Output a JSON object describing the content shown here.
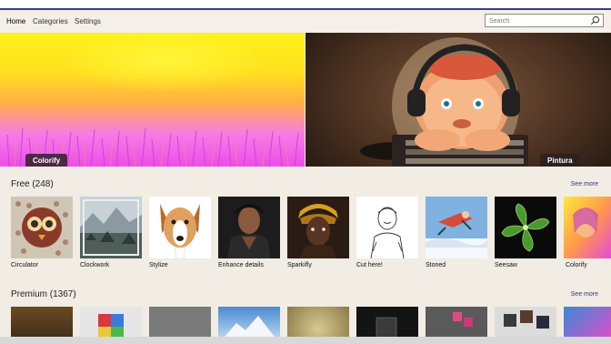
{
  "nav": {
    "items": [
      "Home",
      "Categories",
      "Settings"
    ]
  },
  "search": {
    "placeholder": "Search"
  },
  "hero": {
    "left_label": "Colorify",
    "right_label": "Pintura"
  },
  "sections": {
    "free": {
      "title": "Free (248)",
      "see_more": "See more",
      "items": [
        "Circulator",
        "Clockwork",
        "Stylize",
        "Enhance details",
        "Sparkifly",
        "Cut here!",
        "Stoned",
        "Seesaw",
        "Colorify"
      ]
    },
    "premium": {
      "title": "Premium (1367)",
      "see_more": "See more"
    }
  },
  "colors": {
    "accent": "#34357e",
    "top_border": "#3b3a86"
  }
}
